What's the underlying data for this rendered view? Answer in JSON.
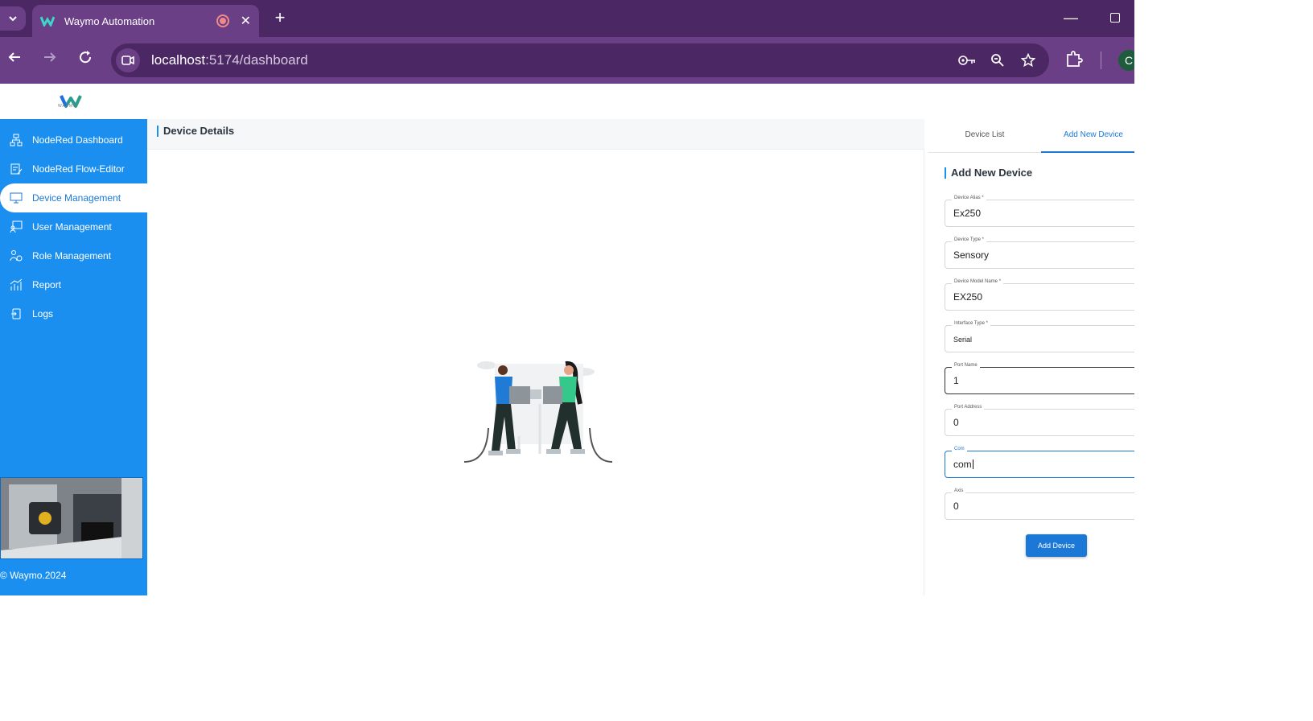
{
  "browser": {
    "tab_title": "Waymo Automation",
    "url_host": "localhost",
    "url_path": ":5174/dashboard",
    "profile_initial": "C"
  },
  "app": {
    "logo_text": "WAYMO",
    "content_title": "Device Details",
    "copyright": "© Waymo.2024"
  },
  "sidebar": {
    "items": [
      {
        "label": "NodeRed Dashboard",
        "icon": "sitemap-icon"
      },
      {
        "label": "NodeRed Flow-Editor",
        "icon": "flow-editor-icon"
      },
      {
        "label": "Device Management",
        "icon": "monitor-icon"
      },
      {
        "label": "User Management",
        "icon": "user-board-icon"
      },
      {
        "label": "Role Management",
        "icon": "role-icon"
      },
      {
        "label": "Report",
        "icon": "bar-chart-icon"
      },
      {
        "label": "Logs",
        "icon": "logs-icon"
      }
    ],
    "active_index": 2
  },
  "panel": {
    "tabs": [
      "Device List",
      "Add New Device"
    ],
    "active_tab": 1,
    "title": "Add New Device",
    "fields": [
      {
        "label": "Device Alias *",
        "value": "Ex250"
      },
      {
        "label": "Device Type *",
        "value": "Sensory"
      },
      {
        "label": "Device Model Name *",
        "value": "EX250"
      },
      {
        "label": "Interface Type *",
        "value": "Serial"
      },
      {
        "label": "Port Name",
        "value": "1"
      },
      {
        "label": "Port Address",
        "value": "0"
      },
      {
        "label": "Com",
        "value": "com"
      },
      {
        "label": "Axis",
        "value": "0"
      }
    ],
    "submit_label": "Add Device"
  },
  "colors": {
    "browser_dark": "#4b2763",
    "browser_light": "#6a3f86",
    "sidebar": "#1b8ff0",
    "accent": "#1b78d6"
  }
}
